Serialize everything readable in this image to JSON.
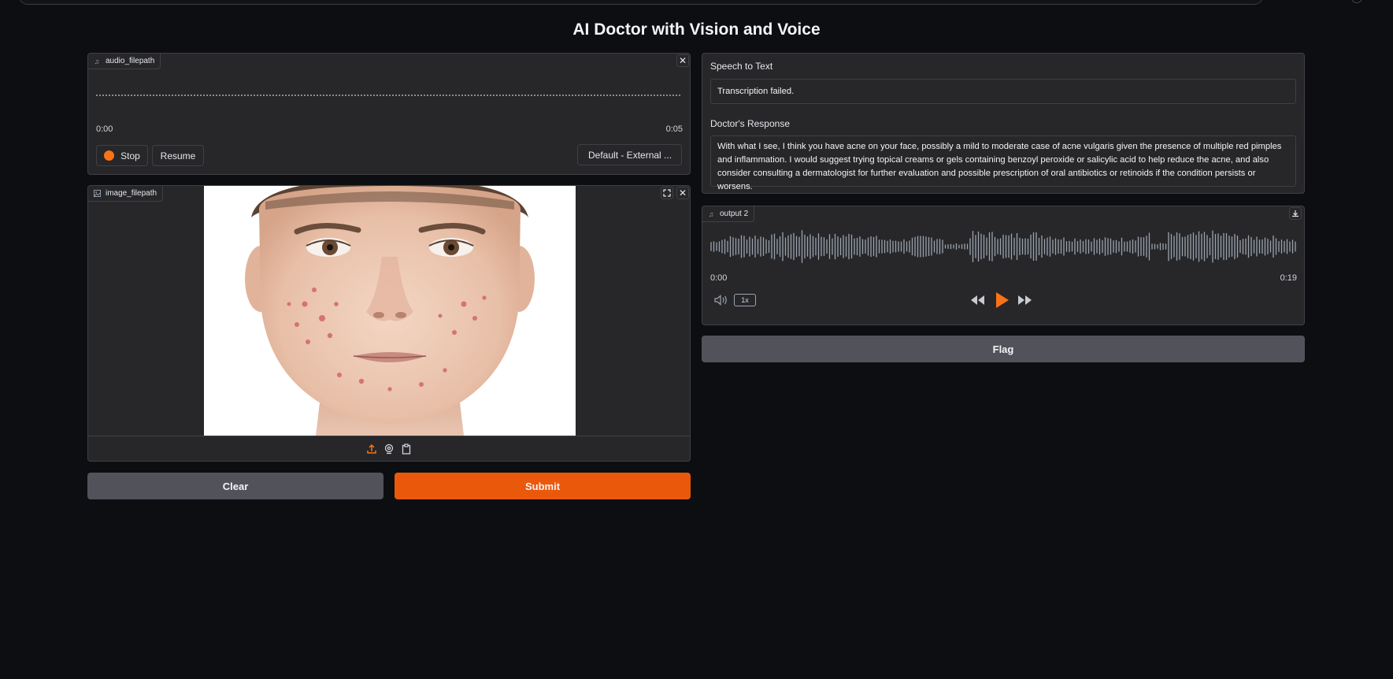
{
  "title": "AI Doctor with Vision and Voice",
  "audio_input": {
    "label": "audio_filepath",
    "time_start": "0:00",
    "time_end": "0:05",
    "stop_label": "Stop",
    "resume_label": "Resume",
    "device": "Default - External ..."
  },
  "image_input": {
    "label": "image_filepath",
    "sources": [
      "upload-icon",
      "webcam-icon",
      "clipboard-icon"
    ]
  },
  "actions": {
    "clear_label": "Clear",
    "submit_label": "Submit",
    "flag_label": "Flag"
  },
  "speech_to_text": {
    "label": "Speech to Text",
    "value": "Transcription failed."
  },
  "doctor_response": {
    "label": "Doctor's Response",
    "value": "With what I see, I think you have acne on your face, possibly a mild to moderate case of acne vulgaris given the presence of multiple red pimples and inflammation. I would suggest trying topical creams or gels containing benzoyl peroxide or salicylic acid to help reduce the acne, and also consider consulting a dermatologist for further evaluation and possible prescription of oral antibiotics or retinoids if the condition persists or worsens."
  },
  "output_audio": {
    "label": "output 2",
    "time_start": "0:00",
    "time_end": "0:19",
    "speed": "1x"
  },
  "colors": {
    "background": "#0d0e11",
    "panel": "#27272a",
    "border": "#3f3f46",
    "accent": "#ea580c",
    "secondary_button": "#52525b"
  }
}
